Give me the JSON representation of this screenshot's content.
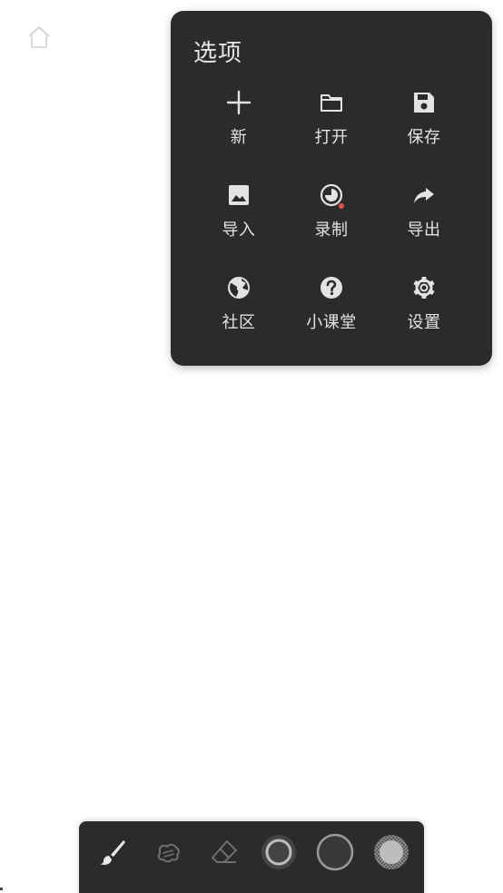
{
  "home": {
    "icon": "home-icon"
  },
  "menu": {
    "title": "选项",
    "items": [
      {
        "label": "新",
        "icon": "plus-icon"
      },
      {
        "label": "打开",
        "icon": "folder-icon"
      },
      {
        "label": "保存",
        "icon": "save-icon"
      },
      {
        "label": "导入",
        "icon": "image-icon"
      },
      {
        "label": "录制",
        "icon": "record-timelapse-icon"
      },
      {
        "label": "导出",
        "icon": "share-icon"
      },
      {
        "label": "社区",
        "icon": "globe-icon"
      },
      {
        "label": "小课堂",
        "icon": "help-icon"
      },
      {
        "label": "设置",
        "icon": "gear-icon"
      }
    ]
  },
  "toolbar": {
    "tools": [
      {
        "name": "brush-tool",
        "icon": "brush-icon",
        "active": true
      },
      {
        "name": "smudge-tool",
        "icon": "smudge-icon",
        "active": false
      },
      {
        "name": "eraser-tool",
        "icon": "eraser-icon",
        "active": false
      },
      {
        "name": "brush-size",
        "icon": "size-ring-icon"
      },
      {
        "name": "color-swatch",
        "icon": "color-icon",
        "color": "#3a3738"
      },
      {
        "name": "brush-opacity",
        "icon": "opacity-icon"
      }
    ]
  },
  "colors": {
    "panel_bg": "#2b2b2e",
    "text": "#e3e3e3",
    "record_dot": "#e85040"
  }
}
